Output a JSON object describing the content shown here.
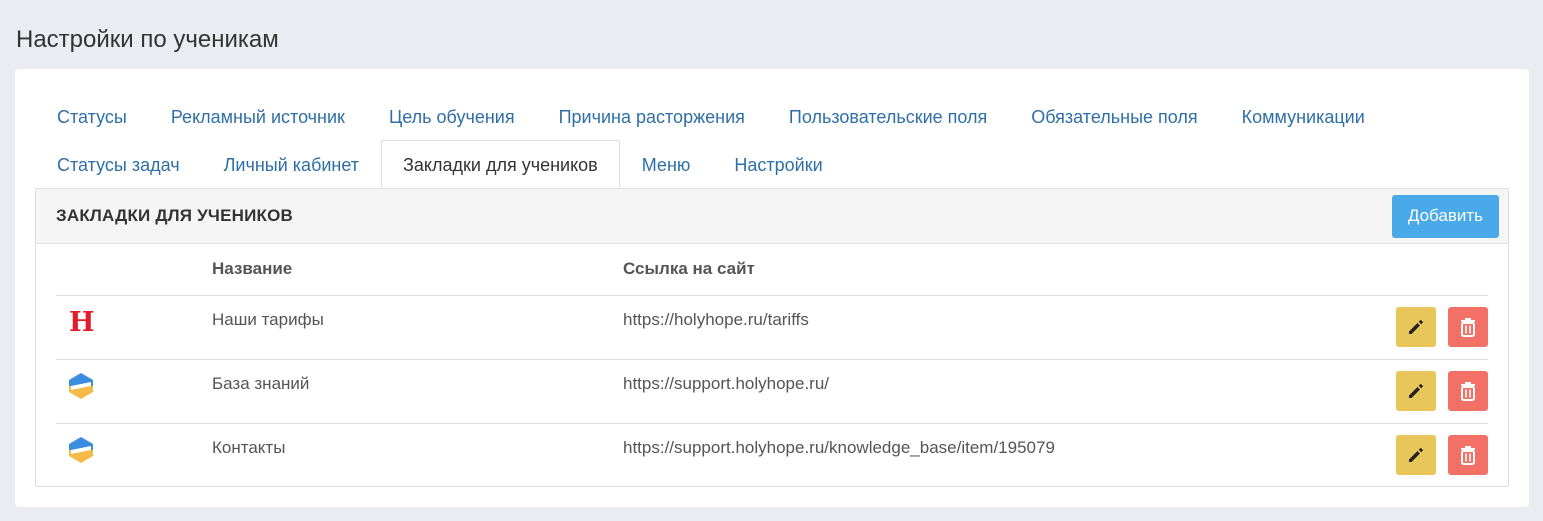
{
  "page": {
    "title": "Настройки по ученикам"
  },
  "tabs": {
    "row1": [
      "Статусы",
      "Рекламный источник",
      "Цель обучения",
      "Причина расторжения",
      "Пользовательские поля",
      "Обязательные поля",
      "Коммуникации"
    ],
    "row2": [
      "Статусы задач",
      "Личный кабинет",
      "Закладки для учеников",
      "Меню",
      "Настройки"
    ],
    "active": "Закладки для учеников"
  },
  "panel": {
    "title": "ЗАКЛАДКИ ДЛЯ УЧЕНИКОВ",
    "add_label": "Добавить"
  },
  "table": {
    "columns": [
      "",
      "Название",
      "Ссылка на сайт",
      ""
    ],
    "rows": [
      {
        "icon": "holyhope-h-logo",
        "name": "Наши тарифы",
        "url": "https://holyhope.ru/tariffs"
      },
      {
        "icon": "knowledge-base-hex-logo",
        "name": "База знаний",
        "url": "https://support.holyhope.ru/"
      },
      {
        "icon": "knowledge-base-hex-logo",
        "name": "Контакты",
        "url": "https://support.holyhope.ru/knowledge_base/item/195079"
      }
    ]
  },
  "icons": {
    "edit": "pencil-icon",
    "delete": "trash-icon"
  },
  "colors": {
    "background": "#e9ecf1",
    "tab_link": "#2f6fa7",
    "add_button": "#4aa9e9",
    "edit_button": "#e9c65a",
    "delete_button": "#f27066",
    "logo_red": "#e21c2a"
  }
}
